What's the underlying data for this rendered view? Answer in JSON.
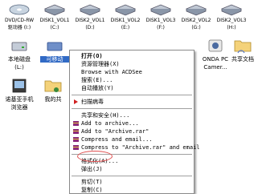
{
  "drives": [
    {
      "name": "DVD/CD-RW",
      "letter": "驱动器 (I:)"
    },
    {
      "name": "DISK1_VOL1",
      "letter": "(C:)"
    },
    {
      "name": "DISK2_VOL1",
      "letter": "(D:)"
    },
    {
      "name": "DISK1_VOL2",
      "letter": "(E:)"
    },
    {
      "name": "DISK1_VOL3",
      "letter": "(F:)"
    },
    {
      "name": "DISK2_VOL2",
      "letter": "(G:)"
    },
    {
      "name": "DISK2_VOL3",
      "letter": "(H:)"
    }
  ],
  "items": [
    {
      "line1": "本地磁盘",
      "line2": "(L:)"
    },
    {
      "line1": "可移动",
      "line2": ""
    },
    {
      "line1": "ONDA PC",
      "line2": "Camer..."
    },
    {
      "line1": "共享文档",
      "line2": ""
    },
    {
      "line1": "诺基亚手机",
      "line2": "浏览器"
    },
    {
      "line1": "我的共",
      "line2": ""
    }
  ],
  "context_menu": {
    "open": "打开(O)",
    "explorer": "资源管理器(X)",
    "browse_acdsee": "Browse with ACDSee",
    "search": "搜索(E)...",
    "autoplay": "自动播放(Y)",
    "scan_virus": "扫描病毒",
    "sharing": "共享和安全(H)...",
    "add_archive": "Add to archive...",
    "add_archive_rar": "Add to \"Archive.rar\"",
    "compress_email": "Compress and email...",
    "compress_rar_email": "Compress to \"Archive.rar\" and email",
    "format": "格式化(A)...",
    "eject": "弹出(J)",
    "cut": "剪切(T)",
    "copy": "复制(C)"
  },
  "colors": {
    "selection": "#316ac5",
    "highlight_ellipse": "#e05050",
    "winrar": "#8b2a7a"
  }
}
